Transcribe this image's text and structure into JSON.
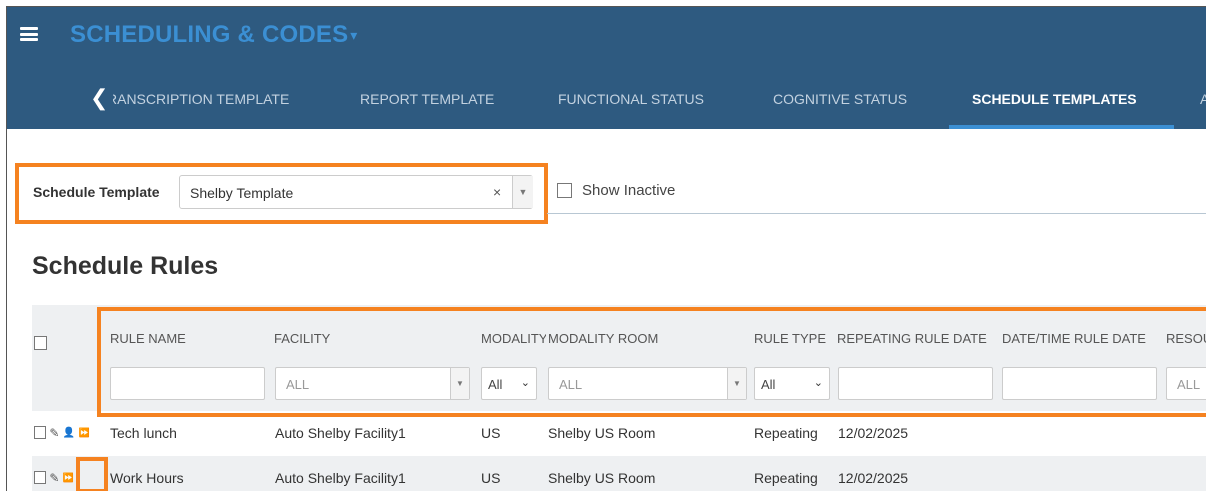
{
  "app": {
    "title": "SCHEDULING & CODES",
    "title_caret": "▾"
  },
  "tabs": {
    "prev_glyph": "❮",
    "items": [
      "RANSCRIPTION TEMPLATE",
      "REPORT TEMPLATE",
      "FUNCTIONAL STATUS",
      "COGNITIVE STATUS",
      "SCHEDULE TEMPLATES",
      "A"
    ],
    "active": "SCHEDULE TEMPLATES"
  },
  "template_filter": {
    "label": "Schedule Template",
    "value": "Shelby Template",
    "clear_glyph": "×",
    "dropdown_glyph": "▼",
    "show_inactive_label": "Show Inactive"
  },
  "rules": {
    "title": "Schedule Rules",
    "columns": [
      "RULE NAME",
      "FACILITY",
      "MODALITY",
      "MODALITY ROOM",
      "RULE TYPE",
      "REPEATING RULE DATE",
      "DATE/TIME RULE DATE",
      "RESOURCE"
    ],
    "filters": {
      "facility_placeholder": "ALL",
      "modality_value": "All",
      "modality_room_placeholder": "ALL",
      "rule_type_value": "All",
      "resource_placeholder": "ALL"
    },
    "rows": [
      {
        "rule_name": "Tech lunch",
        "facility": "Auto Shelby Facility1",
        "modality": "US",
        "modality_room": "Shelby US Room",
        "rule_type": "Repeating",
        "repeating_date": "12/02/2025"
      },
      {
        "rule_name": "Work Hours",
        "facility": "Auto Shelby Facility1",
        "modality": "US",
        "modality_room": "Shelby US Room",
        "rule_type": "Repeating",
        "repeating_date": "12/02/2025"
      }
    ],
    "row_icons": {
      "edit": "✎",
      "user": "👤",
      "forward": "⏩"
    }
  },
  "colors": {
    "header_bg": "#2e5a80",
    "accent": "#3b8fd3",
    "highlight": "#f58220"
  }
}
